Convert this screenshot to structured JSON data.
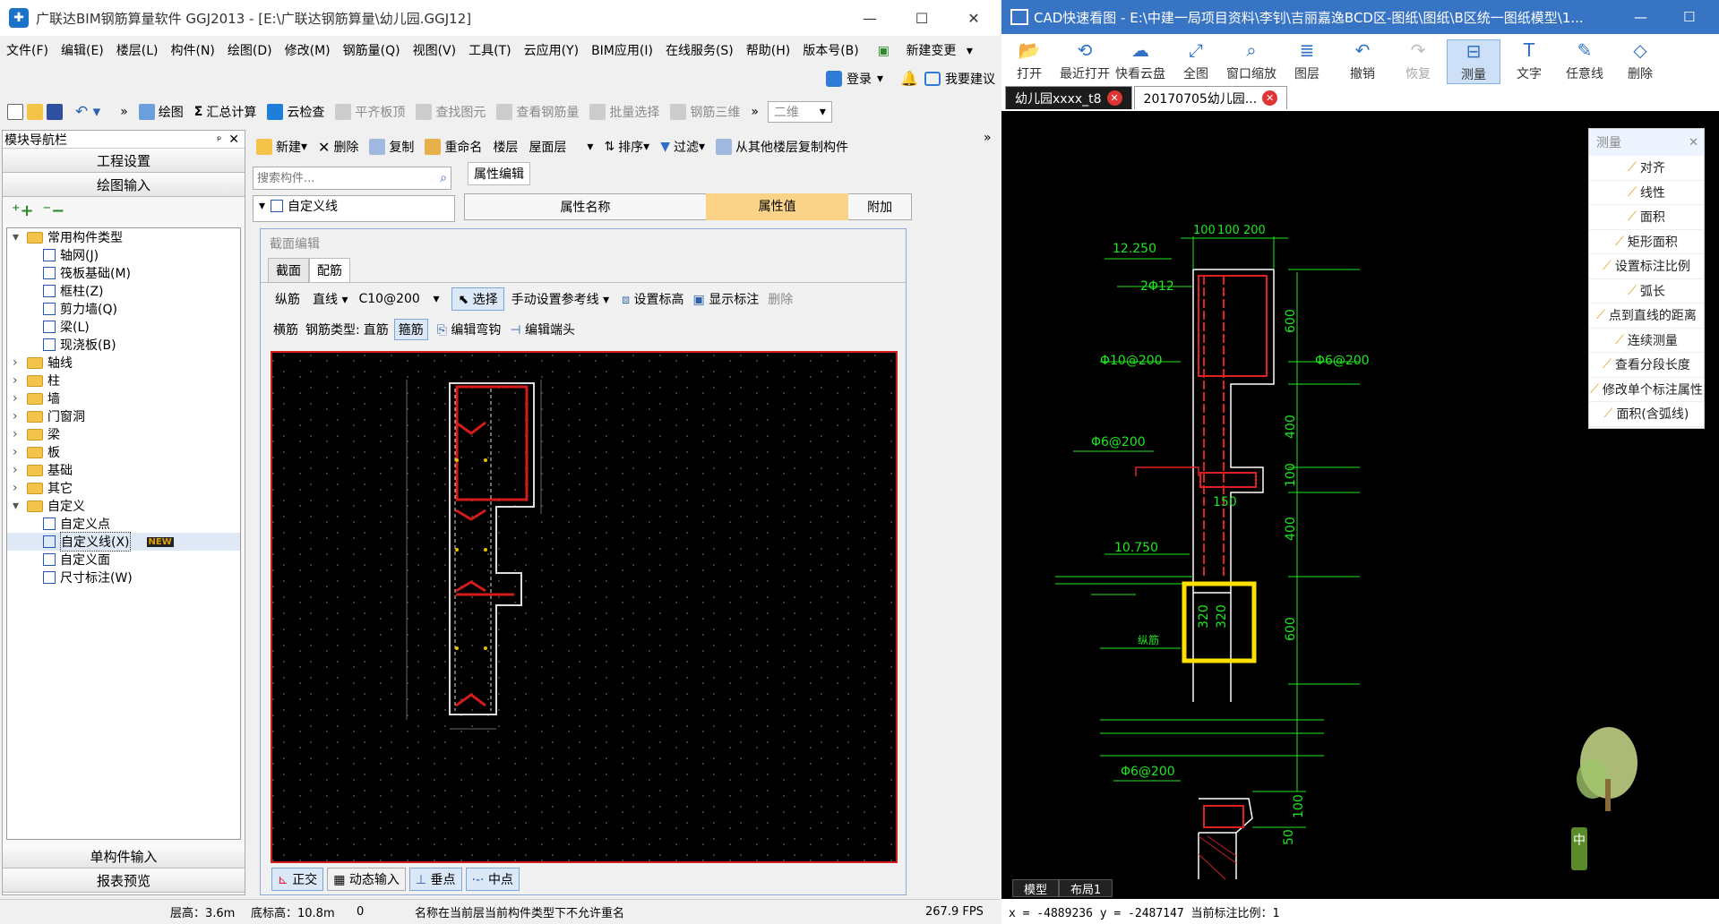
{
  "left_app": {
    "title": "广联达BIM钢筋算量软件 GGJ2013 - [E:\\广联达钢筋算量\\幼儿园.GGJ12]",
    "menu": [
      "文件(F)",
      "编辑(E)",
      "楼层(L)",
      "构件(N)",
      "绘图(D)",
      "修改(M)",
      "钢筋量(Q)",
      "视图(V)",
      "工具(T)",
      "云应用(Y)",
      "BIM应用(I)",
      "在线服务(S)",
      "帮助(H)",
      "版本号(B)",
      "新建变更"
    ],
    "login": "登录",
    "feedback": "我要建议",
    "toolbar1": [
      "绘图",
      "汇总计算",
      "云检查",
      "平齐板顶",
      "查找图元",
      "查看钢筋量",
      "批量选择",
      "钢筋三维",
      "二维"
    ],
    "nav": {
      "header": "模块导航栏",
      "project_settings": "工程设置",
      "draw_input": "绘图输入",
      "single_input": "单构件输入",
      "report_preview": "报表预览",
      "tree": [
        {
          "label": "常用构件类型",
          "level": 0,
          "type": "folder",
          "expanded": true
        },
        {
          "label": "轴网(J)",
          "level": 1,
          "type": "item"
        },
        {
          "label": "筏板基础(M)",
          "level": 1,
          "type": "item"
        },
        {
          "label": "框柱(Z)",
          "level": 1,
          "type": "item"
        },
        {
          "label": "剪力墙(Q)",
          "level": 1,
          "type": "item"
        },
        {
          "label": "梁(L)",
          "level": 1,
          "type": "item"
        },
        {
          "label": "现浇板(B)",
          "level": 1,
          "type": "item"
        },
        {
          "label": "轴线",
          "level": 0,
          "type": "folder"
        },
        {
          "label": "柱",
          "level": 0,
          "type": "folder"
        },
        {
          "label": "墙",
          "level": 0,
          "type": "folder"
        },
        {
          "label": "门窗洞",
          "level": 0,
          "type": "folder"
        },
        {
          "label": "梁",
          "level": 0,
          "type": "folder"
        },
        {
          "label": "板",
          "level": 0,
          "type": "folder"
        },
        {
          "label": "基础",
          "level": 0,
          "type": "folder"
        },
        {
          "label": "其它",
          "level": 0,
          "type": "folder"
        },
        {
          "label": "自定义",
          "level": 0,
          "type": "folder",
          "expanded": true
        },
        {
          "label": "自定义点",
          "level": 1,
          "type": "item"
        },
        {
          "label": "自定义线(X)",
          "level": 1,
          "type": "item",
          "selected": true,
          "badge": "NEW"
        },
        {
          "label": "自定义面",
          "level": 1,
          "type": "item"
        },
        {
          "label": "尺寸标注(W)",
          "level": 1,
          "type": "item"
        }
      ]
    },
    "toolbar2": [
      "新建",
      "删除",
      "复制",
      "重命名",
      "楼层",
      "屋面层",
      "排序",
      "过滤",
      "从其他楼层复制构件"
    ],
    "search_placeholder": "搜索构件...",
    "component_tree_item": "自定义线",
    "props": {
      "tab": "属性编辑",
      "col_name": "属性名称",
      "col_value": "属性值",
      "col_extra": "附加"
    },
    "section_editor": {
      "title": "截面编辑",
      "tabs": [
        "截面",
        "配筋"
      ],
      "row1": {
        "longitudinal": "纵筋",
        "line_type": "直线",
        "spec": "C10@200",
        "select": "选择",
        "manual_ref": "手动设置参考线",
        "set_elev": "设置标高",
        "show_mark": "显示标注",
        "delete": "删除"
      },
      "row2": {
        "transverse": "横筋",
        "rebar_type_label": "钢筋类型:",
        "straight": "直筋",
        "stirrup": "箍筋",
        "edit_hook": "编辑弯钩",
        "edit_end": "编辑端头"
      },
      "bottom": [
        "正交",
        "动态输入",
        "垂点",
        "中点"
      ]
    },
    "status": {
      "floor_height": "层高：3.6m",
      "bottom_elev": "底标高：10.8m",
      "zero": "0",
      "message": "名称在当前层当前构件类型下不允许重名",
      "fps": "267.9 FPS"
    }
  },
  "cad_app": {
    "title": "CAD快速看图 - E:\\中建一局项目资料\\李钊\\吉丽嘉逸BCD区-图纸\\图纸\\B区统一图纸模型\\1...",
    "ribbon": [
      {
        "label": "打开",
        "icon": "folder-open-icon"
      },
      {
        "label": "最近打开",
        "icon": "history-icon"
      },
      {
        "label": "快看云盘",
        "icon": "cloud-icon"
      },
      {
        "label": "全图",
        "icon": "fit-icon"
      },
      {
        "label": "窗口缩放",
        "icon": "zoom-window-icon"
      },
      {
        "label": "图层",
        "icon": "layers-icon"
      },
      {
        "label": "撤销",
        "icon": "undo-icon"
      },
      {
        "label": "恢复",
        "icon": "redo-icon"
      },
      {
        "label": "测量",
        "icon": "measure-icon"
      },
      {
        "label": "文字",
        "icon": "text-icon"
      },
      {
        "label": "任意线",
        "icon": "pen-icon"
      },
      {
        "label": "删除",
        "icon": "eraser-icon"
      }
    ],
    "tabs": [
      "幼儿园xxxx_t8",
      "20170705幼儿园..."
    ],
    "measure_panel": {
      "title": "测量",
      "items": [
        "对齐",
        "线性",
        "面积",
        "矩形面积",
        "设置标注比例",
        "弧长",
        "点到直线的距离",
        "连续测量",
        "查看分段长度",
        "修改单个标注属性",
        "面积(含弧线)"
      ]
    },
    "drawing_labels": {
      "elev_top": "12.250",
      "elev_mid": "10.750",
      "bar_2phi12": "2Φ12",
      "phi10_200": "Φ10@200",
      "phi6_200_right": "Φ6@200",
      "phi6_200_left": "Φ6@200",
      "phi6_200_bottom": "Φ6@200",
      "dim_100_top": "100",
      "dim_100b": "100",
      "dim_200": "200",
      "dim_600a": "600",
      "dim_400a": "400",
      "dim_100c": "100",
      "dim_400b": "400",
      "dim_600b": "600",
      "dim_150": "150",
      "dim_320a": "320",
      "dim_320b": "320",
      "dim_100d": "100",
      "dim_50": "50",
      "side_mark": "纵筋"
    },
    "model_tabs": [
      "模型",
      "布局1"
    ],
    "status": "x = -4889236 y = -2487147 当前标注比例：1",
    "corner_badge": "中"
  }
}
